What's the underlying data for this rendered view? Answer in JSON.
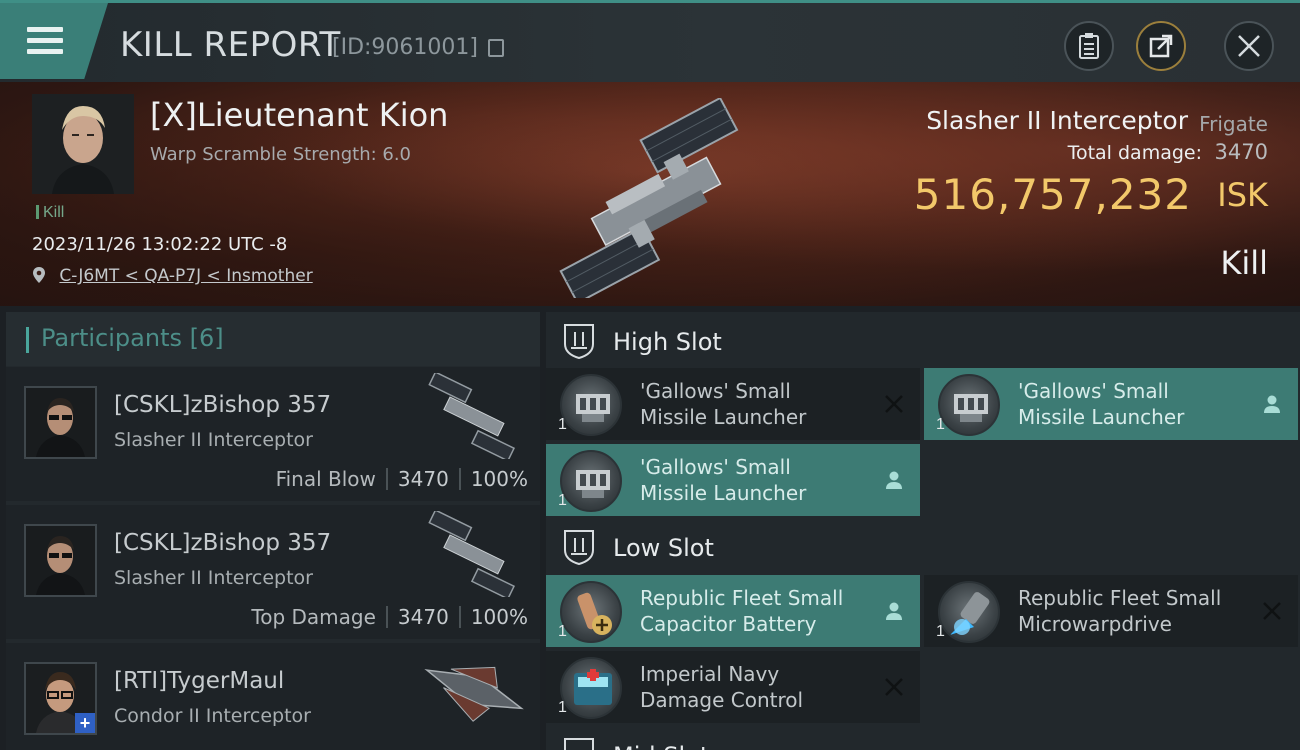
{
  "header": {
    "title": "KILL REPORT",
    "id_text": "[ID:9061001]"
  },
  "victim": {
    "name": "[X]Lieutenant Kion",
    "warp_text": "Warp Scramble Strength: 6.0",
    "kill_tag": "Kill",
    "datetime": "2023/11/26 13:02:22 UTC -8",
    "location": "C-J6MT < QA-P7J < Insmother",
    "ship_name": "Slasher II Interceptor",
    "ship_class": "Frigate",
    "total_damage_label": "Total damage:",
    "total_damage": "3470",
    "isk_value": "516,757,232",
    "isk_unit": "ISK",
    "result": "Kill"
  },
  "participants": {
    "title": "Participants",
    "count": "[6]",
    "rows": [
      {
        "name": "[CSKL]zBishop 357",
        "ship": "Slasher II Interceptor",
        "label": "Final Blow",
        "damage": "3470",
        "percent": "100%"
      },
      {
        "name": "[CSKL]zBishop 357",
        "ship": "Slasher II Interceptor",
        "label": "Top Damage",
        "damage": "3470",
        "percent": "100%"
      },
      {
        "name": "[RTI]TygerMaul",
        "ship": "Condor II Interceptor"
      }
    ]
  },
  "fitting": {
    "high_slot_title": "High Slot",
    "low_slot_title": "Low Slot",
    "mid_slot_title": "Mid Slot",
    "high": [
      {
        "line1": "'Gallows' Small",
        "line2": "Missile Launcher",
        "qty": "1",
        "status": "destroyed"
      },
      {
        "line1": "'Gallows' Small",
        "line2": "Missile Launcher",
        "qty": "1",
        "status": "dropped"
      },
      {
        "line1": "'Gallows' Small",
        "line2": "Missile Launcher",
        "qty": "1",
        "status": "dropped"
      }
    ],
    "low": [
      {
        "line1": "Republic Fleet Small",
        "line2": "Capacitor Battery",
        "qty": "1",
        "status": "dropped"
      },
      {
        "line1": "Republic Fleet Small",
        "line2": "Microwarpdrive",
        "qty": "1",
        "status": "destroyed"
      },
      {
        "line1": "Imperial Navy",
        "line2": "Damage Control",
        "qty": "1",
        "status": "destroyed"
      }
    ]
  },
  "colors": {
    "accent": "#3d7b74",
    "isk": "#f2c86a"
  }
}
